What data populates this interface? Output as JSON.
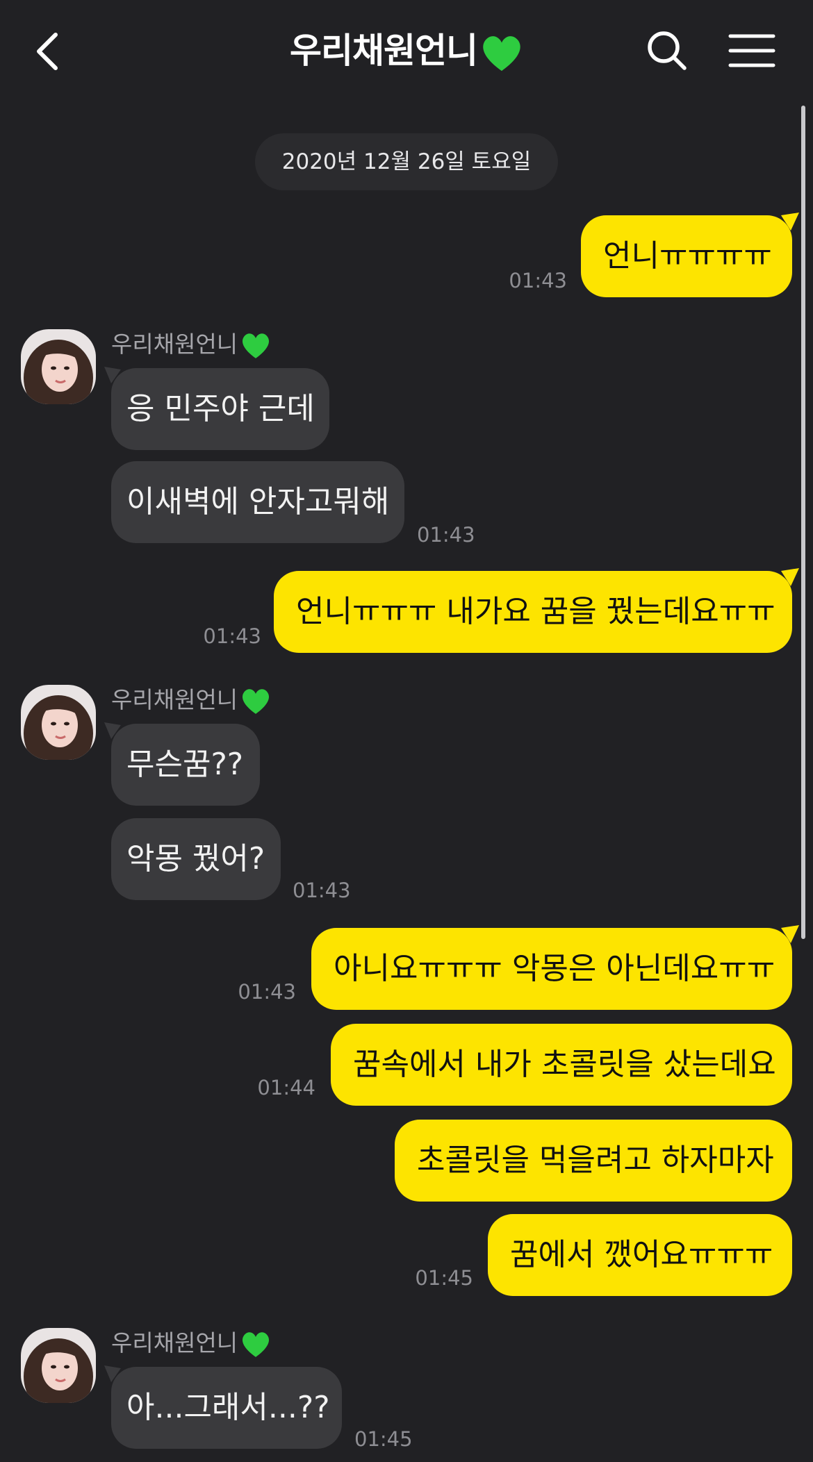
{
  "header": {
    "title": "우리채원언니",
    "back_icon": "chevron-left-icon",
    "search_icon": "search-icon",
    "menu_icon": "hamburger-menu-icon"
  },
  "date_divider": "2020년 12월 26일 토요일",
  "contact": {
    "name": "우리채원언니",
    "heart_icon": "green-heart-icon",
    "heart_color": "#2ecc40"
  },
  "colors": {
    "background": "#212124",
    "my_bubble": "#fde400",
    "their_bubble": "#3a3a3d",
    "timestamp": "#8e8e93"
  },
  "messages": [
    {
      "from": "me",
      "text": "언니ㅠㅠㅠㅠ",
      "time": "01:43"
    },
    {
      "from": "other",
      "text": "응 민주야 근데",
      "time": ""
    },
    {
      "from": "other",
      "text": "이새벽에 안자고뭐해",
      "time": "01:43"
    },
    {
      "from": "me",
      "text": "언니ㅠㅠㅠ 내가요 꿈을 꿨는데요ㅠㅠ",
      "time": "01:43"
    },
    {
      "from": "other",
      "text": "무슨꿈??",
      "time": ""
    },
    {
      "from": "other",
      "text": "악몽 꿨어?",
      "time": "01:43"
    },
    {
      "from": "me",
      "text": "아니요ㅠㅠㅠ 악몽은 아닌데요ㅠㅠ",
      "time": "01:43"
    },
    {
      "from": "me",
      "text": "꿈속에서 내가 초콜릿을 샀는데요",
      "time": "01:44"
    },
    {
      "from": "me",
      "text": "초콜릿을 먹을려고 하자마자",
      "time": ""
    },
    {
      "from": "me",
      "text": "꿈에서 깼어요ㅠㅠㅠ",
      "time": "01:45"
    },
    {
      "from": "other",
      "text": "아...그래서...??",
      "time": "01:45"
    }
  ]
}
